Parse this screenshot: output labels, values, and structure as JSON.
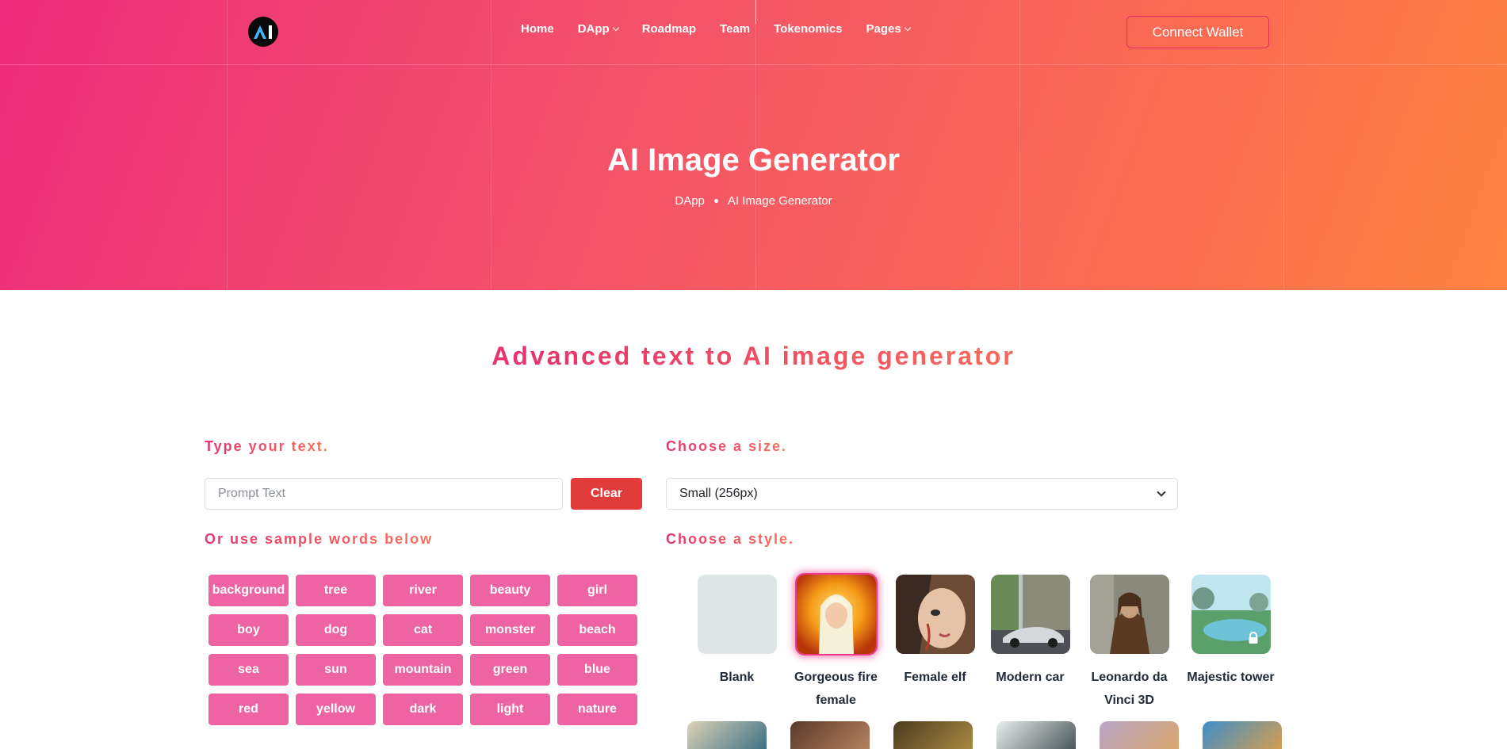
{
  "header": {
    "logo_alt": "AI",
    "nav": [
      {
        "label": "Home",
        "dropdown": false
      },
      {
        "label": "DApp",
        "dropdown": true
      },
      {
        "label": "Roadmap",
        "dropdown": false
      },
      {
        "label": "Team",
        "dropdown": false
      },
      {
        "label": "Tokenomics",
        "dropdown": false
      },
      {
        "label": "Pages",
        "dropdown": true
      }
    ],
    "connect_label": "Connect Wallet"
  },
  "hero": {
    "title": "AI Image Generator",
    "breadcrumb": [
      "DApp",
      "AI Image Generator"
    ]
  },
  "main": {
    "section_title": "Advanced text to AI image generator",
    "prompt_label": "Type your text.",
    "prompt_placeholder": "Prompt Text",
    "clear_label": "Clear",
    "sample_label": "Or use sample words below",
    "sample_words": [
      "background",
      "tree",
      "river",
      "beauty",
      "girl",
      "boy",
      "dog",
      "cat",
      "monster",
      "beach",
      "sea",
      "sun",
      "mountain",
      "green",
      "blue",
      "red",
      "yellow",
      "dark",
      "light",
      "nature"
    ],
    "size_label": "Choose a size.",
    "size_selected": "Small (256px)",
    "style_label": "Choose a style.",
    "styles": [
      {
        "name": "Blank"
      },
      {
        "name": "Gorgeous fire female",
        "selected": true
      },
      {
        "name": "Female elf"
      },
      {
        "name": "Modern car"
      },
      {
        "name": "Leonardo da Vinci 3D"
      },
      {
        "name": "Majestic tower",
        "locked": true
      }
    ]
  },
  "colors": {
    "accent": "#ee3d6c",
    "word_chip": "#ee63a2",
    "clear_button": "#e23b3b"
  }
}
